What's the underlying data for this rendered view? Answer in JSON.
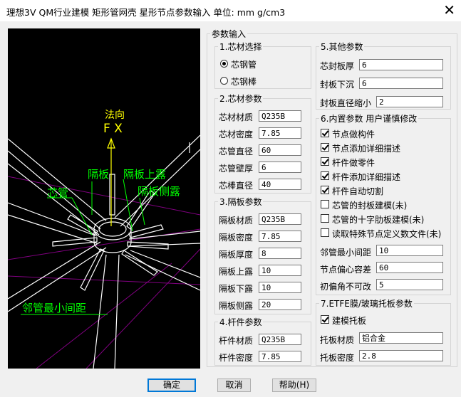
{
  "window": {
    "title": "理想3V QM行业建模 矩形管网壳 星形节点参数输入 单位:  mm  g/cm3",
    "close_glyph": "✕"
  },
  "preview": {
    "labels": {
      "normal_dir": "法向",
      "fx": "F X",
      "partition": "隔板",
      "partition_exposed": "隔板上露",
      "partition_side_exposed": "隔板侧露",
      "core_pipe": "芯管",
      "adjacent_min_spacing": "邻管最小间距"
    },
    "colors": {
      "label": "#ffff00",
      "annotation": "#00ff00",
      "structure": "#ffffff",
      "grid": "#800080"
    }
  },
  "main_group": "参数输入",
  "core_select": {
    "title": "1.芯材选择",
    "options": [
      {
        "label": "芯钢管",
        "selected": true
      },
      {
        "label": "芯钢棒",
        "selected": false
      }
    ]
  },
  "core_params": {
    "title": "2.芯材参数",
    "fields": [
      {
        "label": "芯材材质",
        "value": "Q235B"
      },
      {
        "label": "芯材密度",
        "value": "7.85"
      },
      {
        "label": "芯管直径",
        "value": "60"
      },
      {
        "label": "芯管壁厚",
        "value": "6"
      },
      {
        "label": "芯棒直径",
        "value": "40"
      }
    ]
  },
  "partition_params": {
    "title": "3.隔板参数",
    "fields": [
      {
        "label": "隔板材质",
        "value": "Q235B"
      },
      {
        "label": "隔板密度",
        "value": "7.85"
      },
      {
        "label": "隔板厚度",
        "value": "8"
      },
      {
        "label": "隔板上露",
        "value": "10"
      },
      {
        "label": "隔板下露",
        "value": "10"
      },
      {
        "label": "隔板侧露",
        "value": "20"
      }
    ]
  },
  "member_params": {
    "title": "4.杆件参数",
    "fields": [
      {
        "label": "杆件材质",
        "value": "Q235B"
      },
      {
        "label": "杆件密度",
        "value": "7.85"
      }
    ]
  },
  "other_params": {
    "title": "5.其他参数",
    "fields": [
      {
        "label": "芯封板厚",
        "value": "6"
      },
      {
        "label": "封板下沉",
        "value": "6"
      },
      {
        "label": "封板直径缩小",
        "value": "2"
      }
    ]
  },
  "builtin_params": {
    "title": "6.内置参数 用户谨慎修改",
    "checks": [
      {
        "label": "节点做构件",
        "checked": true
      },
      {
        "label": "节点添加详细描述",
        "checked": true
      },
      {
        "label": "杆件做零件",
        "checked": true
      },
      {
        "label": "杆件添加详细描述",
        "checked": true
      },
      {
        "label": "杆件自动切割",
        "checked": true
      },
      {
        "label": "芯管的封板建模(未)",
        "checked": false
      },
      {
        "label": "芯管的十字肋板建模(未)",
        "checked": false
      },
      {
        "label": "读取特殊节点定义数文件(未)",
        "checked": false
      }
    ],
    "fields": [
      {
        "label": "邻管最小间距",
        "value": "10"
      },
      {
        "label": "节点偏心容差",
        "value": "60"
      },
      {
        "label": "初偏角不可改",
        "value": "5"
      }
    ]
  },
  "etfe_params": {
    "title": "7.ETFE膜/玻璃托板参数",
    "check": {
      "label": "建模托板",
      "checked": true
    },
    "fields": [
      {
        "label": "托板材质",
        "value": "铝合金"
      },
      {
        "label": "托板密度",
        "value": "2.8"
      }
    ]
  },
  "buttons": {
    "ok": "确定",
    "cancel": "取消",
    "help": "帮助(H)"
  }
}
